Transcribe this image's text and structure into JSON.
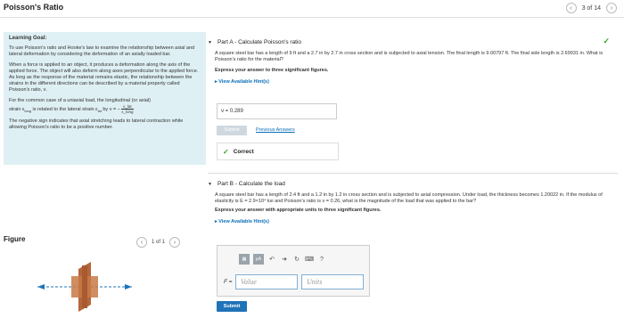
{
  "app": {
    "title": "Poisson's Ratio",
    "pager": "3 of 14"
  },
  "goal": {
    "heading": "Learning Goal:",
    "p1": "To use Poisson's ratio and Hooke's law to examine the relationship between axial and lateral deformation by considering the deformation of an axially loaded bar.",
    "p2": "When a force is applied to an object, it produces a deformation along the axis of the applied force. The object will also deform along axes perpendicular to the applied force. As long as the response of the material remains elastic, the relationship between the strains in the different directions can be described by a material property called Poisson's ratio, ν.",
    "p3a": "For the common case of a uniaxial load, the longitudinal (or axial)",
    "p3b": "strain ε",
    "p3b_sub": "long",
    "p3c": " is related to the lateral strain ε",
    "p3c_sub": "lat",
    "p3d": " by ν = −",
    "frac_num": "ε_lat",
    "frac_den": "ε_long",
    "p4": "The negative sign indicates that axial stretching leads to lateral contraction while allowing Poisson's ratio to be a positive number."
  },
  "figure": {
    "label": "Figure",
    "pager": "1 of 1"
  },
  "partA": {
    "title": "Part A - Calculate Poisson's ratio",
    "question": "A square steel bar has a length of 9 ft and a 2.7 in by 2.7 in cross section and is subjected to axial tension. The final length is 9.00797 ft. The final side length is 2.69931 in. What is Poisson's ratio for the material?",
    "instruction": "Express your answer to three significant figures.",
    "hint": "View Available Hint(s)",
    "answer": "ν = 0.289",
    "submit": "Submit",
    "previous": "Previous Answers",
    "status": "Correct"
  },
  "partB": {
    "title": "Part B - Calculate the load",
    "question": "A square steel bar has a length of 2.4 ft and a 1.2 in by 1.2 in cross section and is subjected to axial compression. Under load, the thickness becomes 1.20022 in. If the modulus of elasticity is E = 2.9×10⁴ ksi and Poisson's ratio is ν = 0.26, what is the magnitude of the load that was applied to the bar?",
    "instruction": "Express your answer with appropriate units to three significant figures.",
    "hint": "View Available Hint(s)",
    "f_label": "F =",
    "value_placeholder": "Value",
    "units_placeholder": "Units",
    "submit": "Submit",
    "toolbar": {
      "mu": "μA",
      "help": "?"
    }
  }
}
